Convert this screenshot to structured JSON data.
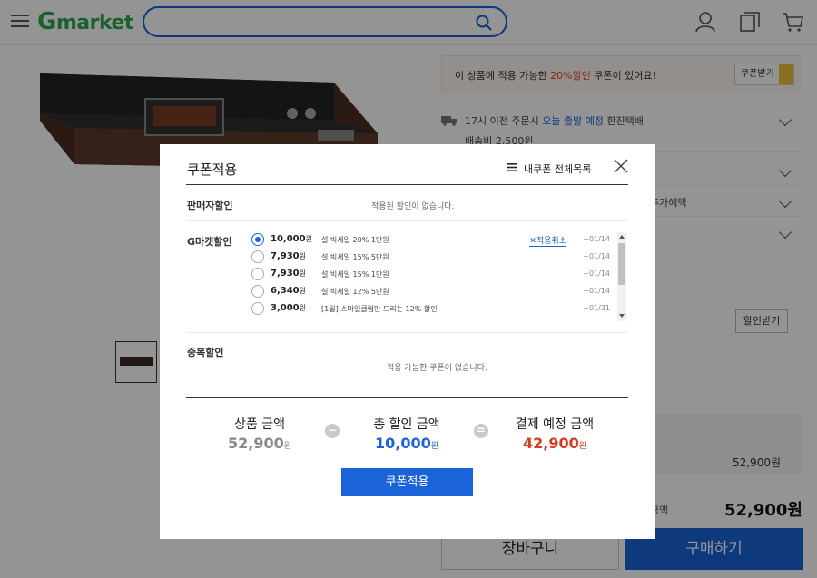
{
  "header": {
    "logo_g": "G",
    "logo_rest": "market",
    "search_placeholder": ""
  },
  "page": {
    "coupon_banner": {
      "text_prefix": "이 상품에 적용 가능한",
      "discount": "20%할인",
      "text_suffix": "쿠폰이 있어요!",
      "button": "쿠폰받기"
    },
    "shipping": {
      "line1_prefix": "17시 이전 주문시",
      "line1_highlight": "오늘 출발 예정",
      "line1_suffix": "한진택배",
      "line2": "배송비 2,500원"
    },
    "extra_benefit": "추가혜택",
    "discount_button": "할인받기",
    "total_value": "52,900원",
    "final_label": "금액",
    "final_price": "52,900원",
    "cart_button": "장바구니",
    "buy_button": "구매하기"
  },
  "modal": {
    "title": "쿠폰적용",
    "my_coupons": "내쿠폰 전체목록",
    "seller_discount": {
      "label": "판매자할인",
      "note": "적용된 할인이 없습니다."
    },
    "gmarket_discount": {
      "label": "G마켓할인",
      "cancel_link": "✕적용취소",
      "coupons": [
        {
          "amount": "10,000",
          "unit": "원",
          "name": "설 빅세일 20% 1만원",
          "date": "~01/14",
          "selected": true
        },
        {
          "amount": "7,930",
          "unit": "원",
          "name": "설 빅세일 15% 5만원",
          "date": "~01/14",
          "selected": false
        },
        {
          "amount": "7,930",
          "unit": "원",
          "name": "설 빅세일 15% 1만원",
          "date": "~01/14",
          "selected": false
        },
        {
          "amount": "6,340",
          "unit": "원",
          "name": "설 빅세일 12% 5만원",
          "date": "~01/14",
          "selected": false
        },
        {
          "amount": "3,000",
          "unit": "원",
          "name": "[1월] 스마일클럽만 드리는 12% 할인",
          "date": "~01/31",
          "selected": false
        }
      ]
    },
    "stack_discount": {
      "label": "중복할인",
      "note": "적용 가능한 쿠폰이 없습니다."
    },
    "summary": {
      "product_label": "상품 금액",
      "product_amount": "52,900",
      "discount_label": "총 할인 금액",
      "discount_amount": "10,000",
      "pay_label": "결제 예정 금액",
      "pay_amount": "42,900",
      "unit": "원",
      "minus": "−",
      "equals": "="
    },
    "apply_button": "쿠폰적용"
  },
  "colors": {
    "brand_green": "#2fa84f",
    "accent_blue": "#1a63d8",
    "price_gray": "#888888",
    "discount_blue": "#1a63d8",
    "pay_red": "#d9371f"
  }
}
